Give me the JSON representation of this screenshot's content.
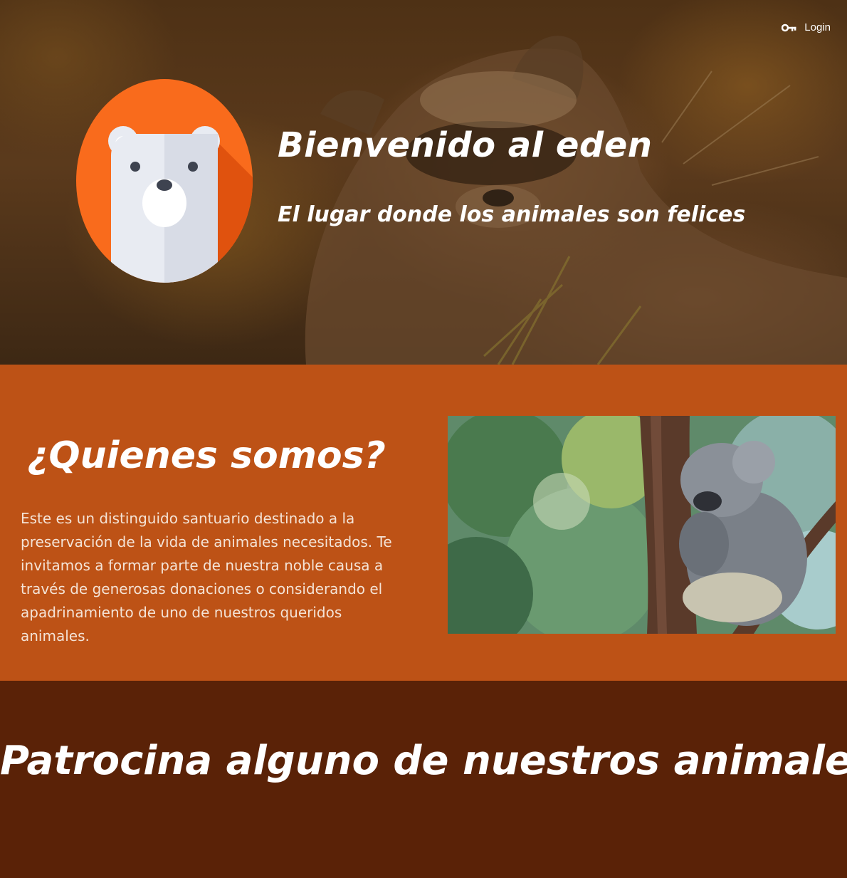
{
  "header": {
    "login_label": "Login",
    "login_icon": "key-icon"
  },
  "hero": {
    "title": "Bienvenido al eden",
    "subtitle": "El lugar donde los animales son felices",
    "logo_icon": "bear-logo-icon",
    "background_image": "raccoon-photo"
  },
  "about": {
    "title": "¿Quienes somos?",
    "text": "Este es un distinguido santuario destinado a la preservación de la vida de animales necesitados. Te invitamos a formar parte de nuestra noble causa a través de generosas donaciones o considerando el apadrinamiento de uno de nuestros queridos animales.",
    "image": "koala-photo"
  },
  "sponsor": {
    "title": "Patrocina alguno de nuestros animales"
  },
  "colors": {
    "hero_overlay": "#4e3115",
    "about_bg": "#bd5216",
    "sponsor_bg": "#5a2207",
    "logo_orange": "#f96b1c",
    "text": "#ffffff"
  }
}
